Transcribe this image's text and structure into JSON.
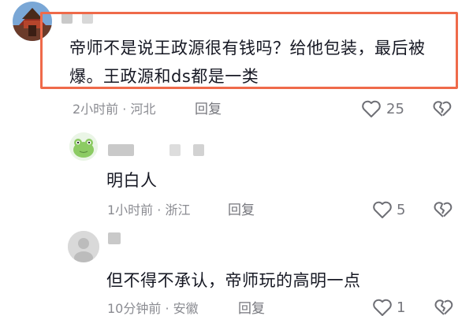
{
  "comments": [
    {
      "text": "帝师不是说王政源很有钱吗？给他包装，最后被爆。王政源和ds都是一类",
      "meta": "2小时前 · 河北",
      "reply_label": "回复",
      "likes": "25"
    },
    {
      "text": "明白人",
      "meta": "1小时前 · 浙江",
      "reply_label": "回复",
      "likes": "5"
    },
    {
      "text": "但不得不承认，帝师玩的高明一点",
      "meta": "10分钟前 · 安徽",
      "reply_label": "回复",
      "likes": "1"
    }
  ],
  "icons": {
    "like": "heart-icon",
    "dislike": "broken-heart-icon"
  },
  "colors": {
    "highlight_border": "#ef6a4a",
    "text": "#161823",
    "meta": "#8a8b91"
  }
}
